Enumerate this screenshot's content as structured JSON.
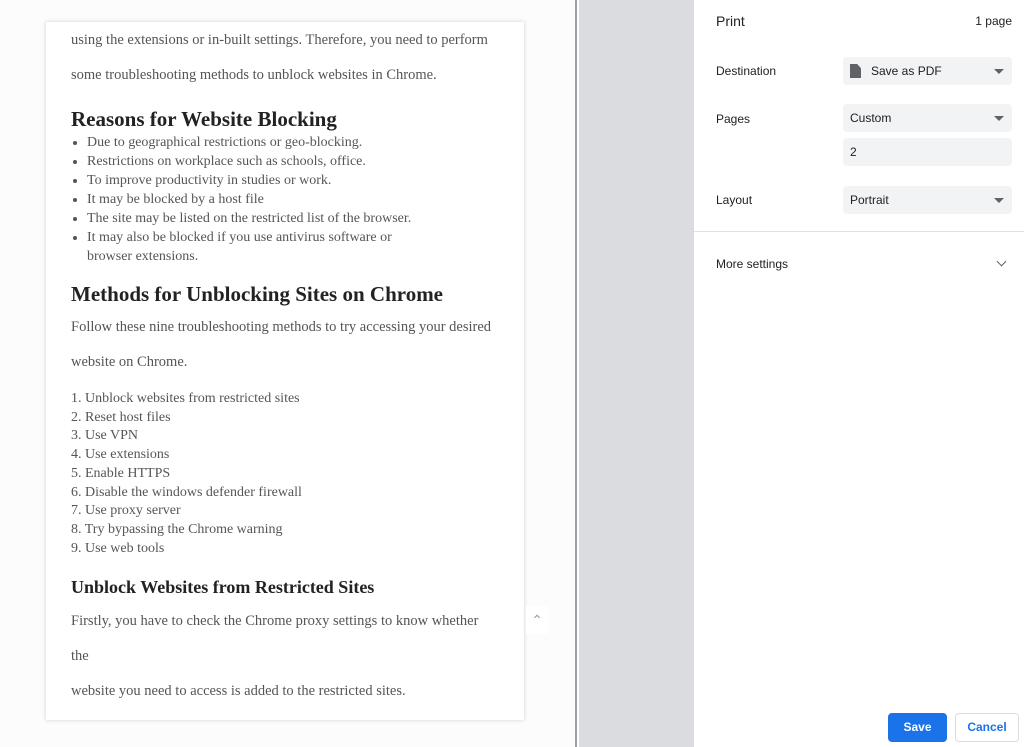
{
  "document": {
    "intro": [
      "using the extensions or in-built settings. Therefore, you need to perform",
      "some troubleshooting methods to unblock websites in Chrome."
    ],
    "h_reasons": "Reasons for Website Blocking",
    "reasons": [
      "Due to geographical restrictions or geo-blocking.",
      "Restrictions on workplace such as schools, office.",
      "To improve productivity in studies or work.",
      "It may be blocked by a host file",
      "The site may be listed on the restricted list of the browser.",
      "It may also be blocked if you use antivirus software or browser extensions."
    ],
    "h_methods": "Methods for Unblocking Sites on Chrome",
    "methods_intro": [
      "Follow these nine troubleshooting methods to try accessing your desired",
      "website on Chrome."
    ],
    "methods": [
      "1. Unblock websites from restricted sites",
      "2. Reset host files",
      "3. Use VPN",
      "4. Use extensions",
      "5. Enable HTTPS",
      "6. Disable the windows defender firewall",
      "7. Use proxy server",
      "8. Try bypassing the Chrome warning",
      "9. Use web tools"
    ],
    "h_unblock": "Unblock Websites from Restricted Sites",
    "unblock_text": [
      "Firstly, you have to check the Chrome proxy settings to know whether the",
      "website you need to access is added to the restricted sites."
    ]
  },
  "print": {
    "title": "Print",
    "page_count": "1 page",
    "destination_label": "Destination",
    "destination_value": "Save as PDF",
    "destination_icon": "file-icon",
    "pages_label": "Pages",
    "pages_value": "Custom",
    "pages_custom": "2",
    "layout_label": "Layout",
    "layout_value": "Portrait",
    "more_settings": "More settings",
    "save": "Save",
    "cancel": "Cancel",
    "accent": "#1a73e8"
  }
}
